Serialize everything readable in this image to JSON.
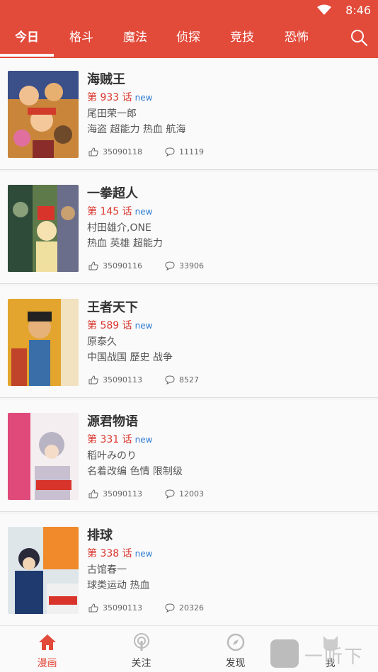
{
  "status": {
    "time": "8:46"
  },
  "tabs": [
    {
      "label": "今日"
    },
    {
      "label": "格斗"
    },
    {
      "label": "魔法"
    },
    {
      "label": "侦探"
    },
    {
      "label": "竞技"
    },
    {
      "label": "恐怖"
    }
  ],
  "comics": [
    {
      "title": "海贼王",
      "chapter": "第 933 话",
      "new": "new",
      "author": "尾田荣一郎",
      "tags": "海盗 超能力 热血 航海",
      "likes": "35090118",
      "comments": "11119"
    },
    {
      "title": "一拳超人",
      "chapter": "第 145 话",
      "new": "new",
      "author": "村田雄介,ONE",
      "tags": "热血 英雄 超能力",
      "likes": "35090116",
      "comments": "33906"
    },
    {
      "title": "王者天下",
      "chapter": "第 589 话",
      "new": "new",
      "author": "原泰久",
      "tags": "中国战国 歷史 战争",
      "likes": "35090113",
      "comments": "8527"
    },
    {
      "title": "源君物语",
      "chapter": "第 331 话",
      "new": "new",
      "author": "稻叶みのり",
      "tags": "名着改编 色情 限制级",
      "likes": "35090113",
      "comments": "12003"
    },
    {
      "title": "排球",
      "chapter": "第 338 话",
      "new": "new",
      "author": "古馆春一",
      "tags": "球类运动 热血",
      "likes": "35090113",
      "comments": "20326"
    }
  ],
  "bottom_nav": [
    {
      "label": "漫画",
      "icon": "home-icon"
    },
    {
      "label": "关注",
      "icon": "podcast-icon"
    },
    {
      "label": "发现",
      "icon": "compass-icon"
    },
    {
      "label": "我",
      "icon": "cat-icon"
    }
  ],
  "watermark": {
    "text": "一听下载"
  },
  "colors": {
    "accent": "#e24a3a",
    "chapter": "#d9342b",
    "new": "#2f7bd3"
  }
}
